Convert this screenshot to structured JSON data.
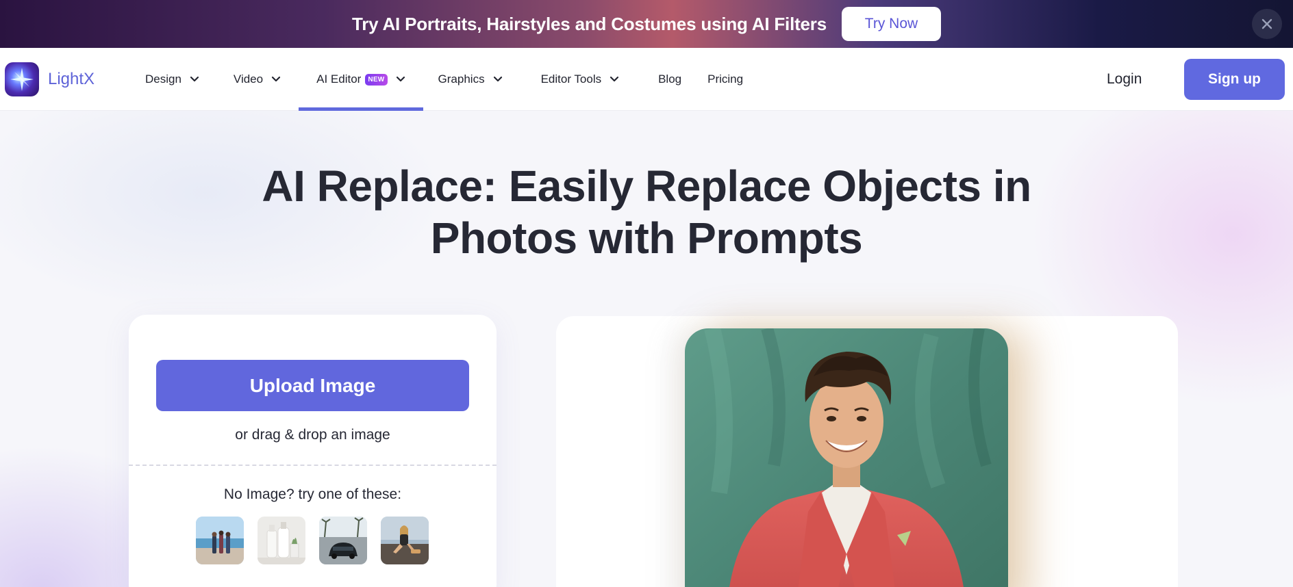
{
  "promo": {
    "text": "Try AI Portraits, Hairstyles and Costumes using AI Filters",
    "button": "Try Now",
    "close_icon": "close-icon"
  },
  "nav": {
    "brand": "LightX",
    "items": [
      {
        "label": "Design",
        "dropdown": true
      },
      {
        "label": "Video",
        "dropdown": true
      },
      {
        "label": "AI Editor",
        "badge": "NEW",
        "dropdown": true,
        "active": true
      },
      {
        "label": "Graphics",
        "dropdown": true
      },
      {
        "label": "Editor Tools",
        "dropdown": true
      },
      {
        "label": "Blog",
        "dropdown": false
      },
      {
        "label": "Pricing",
        "dropdown": false
      }
    ],
    "login": "Login",
    "signup": "Sign up"
  },
  "hero": {
    "title_line1": "AI Replace: Easily Replace Objects in",
    "title_line2": "Photos with Prompts"
  },
  "upload": {
    "button": "Upload Image",
    "drag_text": "or drag & drop an image",
    "try_text": "No Image? try one of these:",
    "samples": [
      "beach-couple-sample",
      "bottles-sample",
      "car-sample",
      "woman-sample"
    ]
  },
  "colors": {
    "accent": "#6069e0",
    "text": "#262834",
    "promo_button_text": "#5a55d6"
  }
}
